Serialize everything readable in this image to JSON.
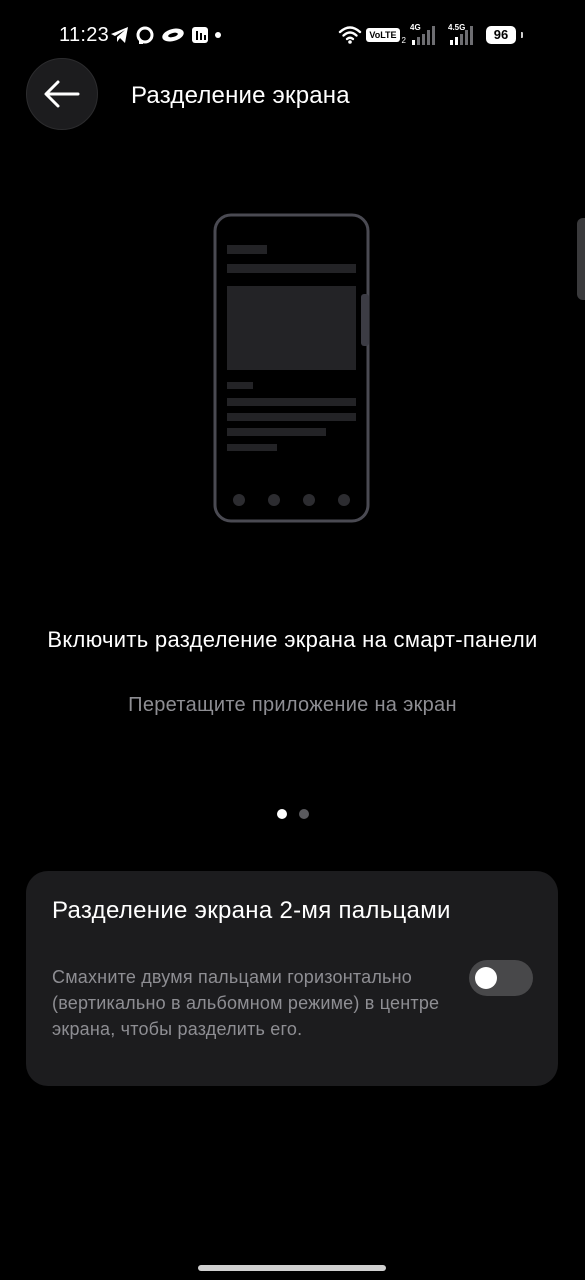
{
  "status_bar": {
    "time": "11:23",
    "left_icons": [
      "telegram-icon",
      "threads-icon",
      "sticker-app-icon",
      "notes-app-icon",
      "more-dot-icon"
    ],
    "right_icons": [
      "wifi-icon",
      "volte-icon",
      "signal-4g-icon",
      "signal-45g-icon",
      "battery-icon"
    ],
    "volte_label": "VoLTE",
    "volte_sub": "2",
    "net1_label": "4G",
    "net2_label": "4.5G",
    "battery_level": "96"
  },
  "header": {
    "back_icon": "arrow-left-icon",
    "title": "Разделение экрана"
  },
  "illustration": {
    "icon": "phone-mockup-illustration"
  },
  "carousel": {
    "title": "Включить разделение экрана на смарт-панели",
    "subtitle": "Перетащите приложение на экран",
    "page_count": 2,
    "active_page": 1
  },
  "setting": {
    "title": "Разделение экрана 2-мя пальцами",
    "description": "Смахните двумя пальцами горизонтально (вертикально в альбомном режиме) в центре экрана, чтобы разделить его.",
    "toggle_on": false
  },
  "colors": {
    "background": "#000000",
    "card": "#1c1c1e",
    "secondary_text": "#8e8e93",
    "toggle_off": "#48484a"
  }
}
